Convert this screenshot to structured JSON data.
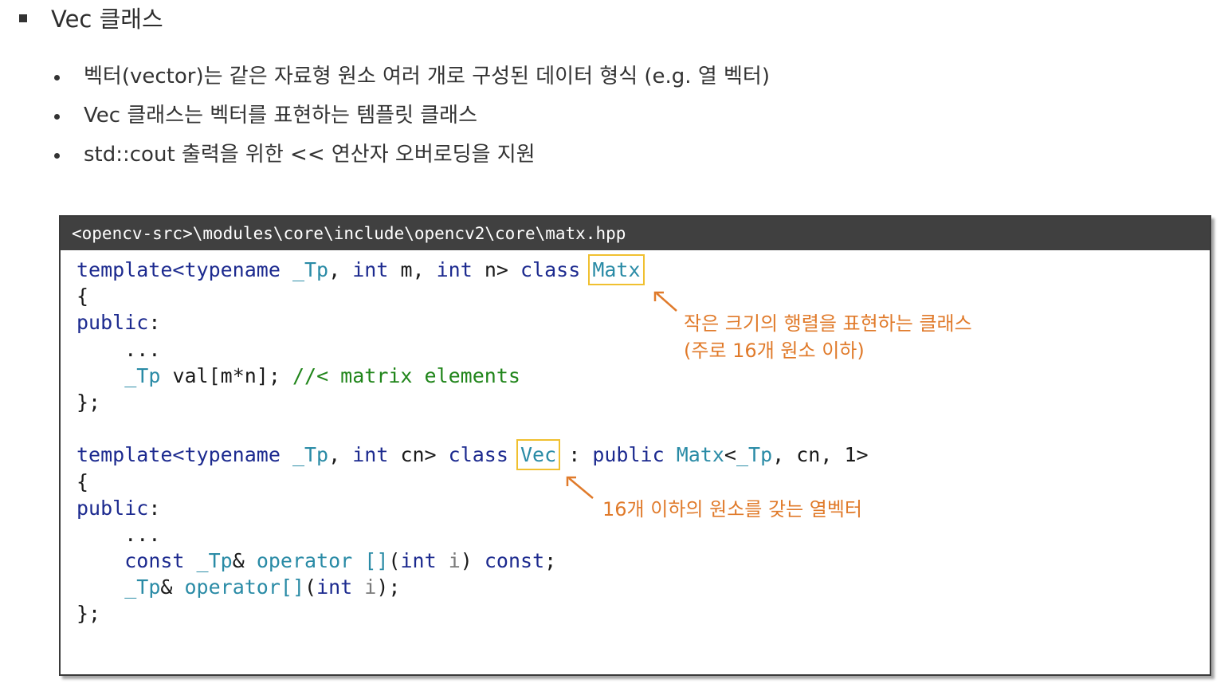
{
  "heading": "Vec 클래스",
  "bullets": [
    "벡터(vector)는 같은 자료형 원소 여러 개로 구성된 데이터 형식 (e.g. 열 벡터)",
    "Vec 클래스는 벡터를 표현하는 템플릿 클래스",
    "std::cout 출력을 위한 << 연산자 오버로딩을 지원"
  ],
  "code_box": {
    "path": "<opencv-src>\\modules\\core\\include\\opencv2\\core\\matx.hpp",
    "matx": {
      "template": "template<typename",
      "tp": "_Tp",
      "comma": ",",
      "int1": "int",
      "m": "m,",
      "int2": "int",
      "n": "n>",
      "class": "class",
      "name": "Matx",
      "open": "{",
      "public": "public",
      "colon": ":",
      "ellipsis": "...",
      "member_tp": "_Tp",
      "member": "val[m*n];",
      "comment": "//< matrix elements",
      "close": "};"
    },
    "vec": {
      "template": "template<typename",
      "tp": "_Tp",
      "comma": ",",
      "int": "int",
      "cn": "cn>",
      "class": "class",
      "name": "Vec",
      "inherit_colon": ":",
      "public_kw": "public",
      "base": "Matx",
      "base_lt": "<",
      "base_tp": "_Tp",
      "base_args": ", cn, 1>",
      "open": "{",
      "public": "public",
      "colon": ":",
      "ellipsis": "...",
      "op1_const": "const",
      "op1_tp": "_Tp",
      "op1_amp": "&",
      "op1_operator": "operator []",
      "op1_paren_open": "(",
      "op1_int": "int",
      "op1_i": "i",
      "op1_paren_close": ")",
      "op1_const2": "const",
      "op1_semi": ";",
      "op2_tp": "_Tp",
      "op2_amp": "&",
      "op2_operator": "operator[]",
      "op2_paren_open": "(",
      "op2_int": "int",
      "op2_i": "i",
      "op2_end": ");",
      "close": "};"
    }
  },
  "annotations": {
    "matx_line1": "작은 크기의 행렬을 표현하는 클래스",
    "matx_line2": "(주로 16개 원소 이하)",
    "vec": "16개 이하의 원소를 갖는 열벡터"
  },
  "colors": {
    "keyword": "#1c2a8f",
    "type": "#2a8ba6",
    "comment": "#20851a",
    "highlight_box": "#f0c030",
    "annotation": "#e07a2a",
    "path_bar": "#404040"
  }
}
